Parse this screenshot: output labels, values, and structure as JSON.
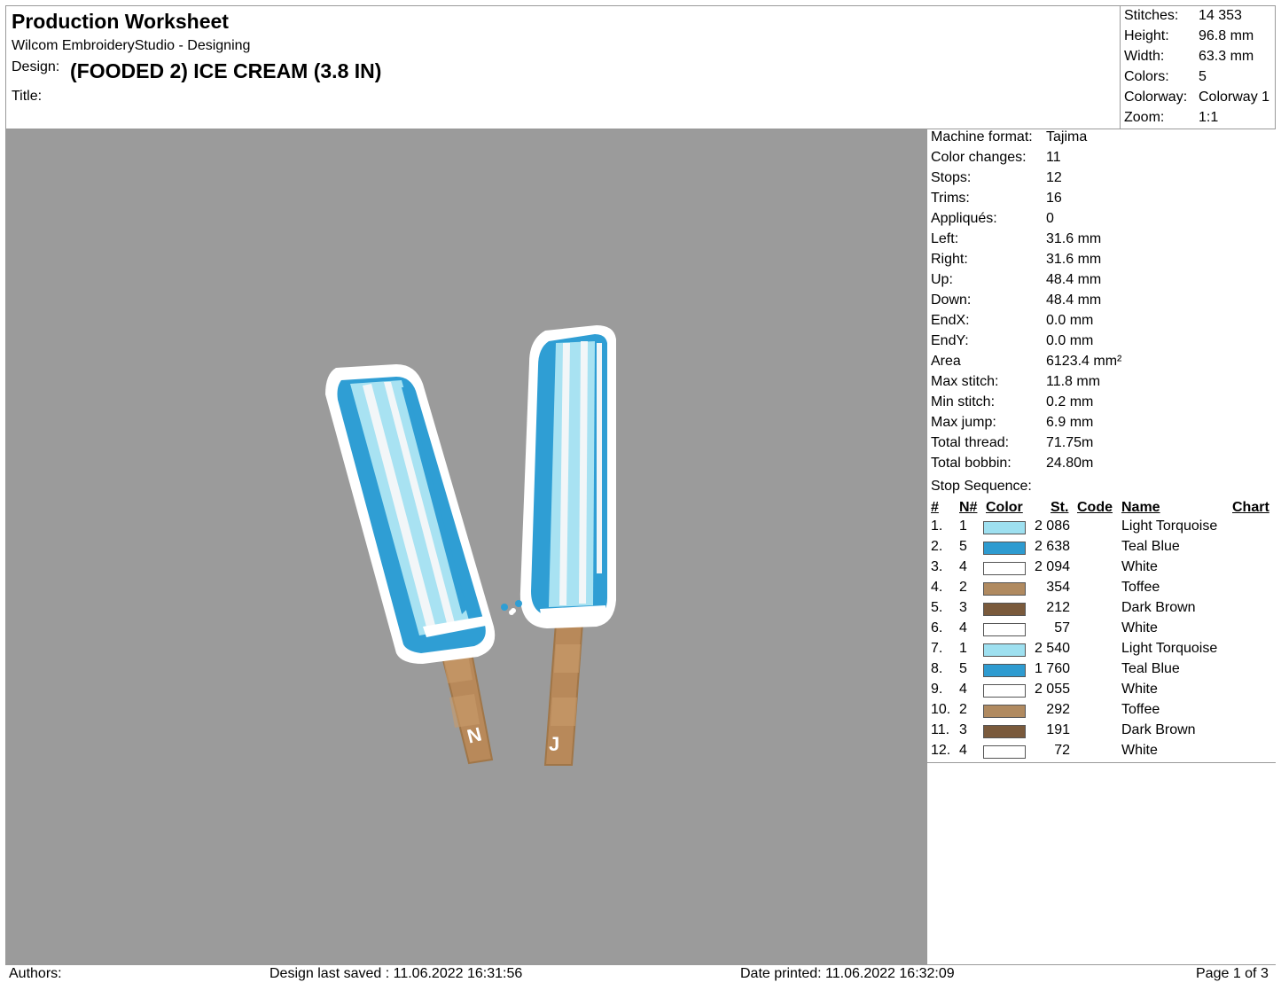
{
  "header": {
    "title": "Production Worksheet",
    "app": "Wilcom EmbroideryStudio - Designing",
    "design_label": "Design:",
    "design_value": "(FOODED 2) ICE CREAM (3.8 IN)",
    "title_label": "Title:"
  },
  "stats": [
    {
      "k": "Stitches:",
      "v": "14 353"
    },
    {
      "k": "Height:",
      "v": "96.8 mm"
    },
    {
      "k": "Width:",
      "v": "63.3 mm"
    },
    {
      "k": "Colors:",
      "v": "5"
    },
    {
      "k": "Colorway:",
      "v": "Colorway 1"
    },
    {
      "k": "Zoom:",
      "v": "1:1"
    }
  ],
  "info": [
    {
      "k": "Machine format:",
      "v": "Tajima"
    },
    {
      "k": "Color changes:",
      "v": "11"
    },
    {
      "k": "Stops:",
      "v": "12"
    },
    {
      "k": "Trims:",
      "v": "16"
    },
    {
      "k": "Appliqués:",
      "v": "0"
    },
    {
      "k": "Left:",
      "v": "31.6 mm"
    },
    {
      "k": "Right:",
      "v": "31.6 mm"
    },
    {
      "k": "Up:",
      "v": "48.4 mm"
    },
    {
      "k": "Down:",
      "v": "48.4 mm"
    },
    {
      "k": "EndX:",
      "v": "0.0 mm"
    },
    {
      "k": "EndY:",
      "v": "0.0 mm"
    },
    {
      "k": "Area",
      "v": "6123.4 mm²"
    },
    {
      "k": "Max stitch:",
      "v": "11.8 mm"
    },
    {
      "k": "Min stitch:",
      "v": "0.2 mm"
    },
    {
      "k": "Max jump:",
      "v": "6.9 mm"
    },
    {
      "k": "Total thread:",
      "v": "71.75m"
    },
    {
      "k": "Total bobbin:",
      "v": "24.80m"
    }
  ],
  "stop_sequence": {
    "title": "Stop Sequence:",
    "headers": {
      "num": "#",
      "n": "N#",
      "color": "Color",
      "st": "St.",
      "code": "Code",
      "name": "Name",
      "chart": "Chart"
    },
    "rows": [
      {
        "num": "1.",
        "n": "1",
        "color": "#9ee0f0",
        "st": "2 086",
        "code": "",
        "name": "Light Torquoise"
      },
      {
        "num": "2.",
        "n": "5",
        "color": "#2e9bd0",
        "st": "2 638",
        "code": "",
        "name": "Teal Blue"
      },
      {
        "num": "3.",
        "n": "4",
        "color": "#ffffff",
        "st": "2 094",
        "code": "",
        "name": "White"
      },
      {
        "num": "4.",
        "n": "2",
        "color": "#b08a60",
        "st": "354",
        "code": "",
        "name": "Toffee"
      },
      {
        "num": "5.",
        "n": "3",
        "color": "#7a5a3c",
        "st": "212",
        "code": "",
        "name": "Dark Brown"
      },
      {
        "num": "6.",
        "n": "4",
        "color": "#ffffff",
        "st": "57",
        "code": "",
        "name": "White"
      },
      {
        "num": "7.",
        "n": "1",
        "color": "#9ee0f0",
        "st": "2 540",
        "code": "",
        "name": "Light Torquoise"
      },
      {
        "num": "8.",
        "n": "5",
        "color": "#2e9bd0",
        "st": "1 760",
        "code": "",
        "name": "Teal Blue"
      },
      {
        "num": "9.",
        "n": "4",
        "color": "#ffffff",
        "st": "2 055",
        "code": "",
        "name": "White"
      },
      {
        "num": "10.",
        "n": "2",
        "color": "#b08a60",
        "st": "292",
        "code": "",
        "name": "Toffee"
      },
      {
        "num": "11.",
        "n": "3",
        "color": "#7a5a3c",
        "st": "191",
        "code": "",
        "name": "Dark Brown"
      },
      {
        "num": "12.",
        "n": "4",
        "color": "#ffffff",
        "st": "72",
        "code": "",
        "name": "White"
      }
    ]
  },
  "design_letters": {
    "left": "N",
    "right": "J"
  },
  "footer": {
    "authors": "Authors:",
    "saved": "Design last saved : 11.06.2022 16:31:56",
    "printed": "Date printed: 11.06.2022 16:32:09",
    "page": "Page 1 of 3"
  }
}
